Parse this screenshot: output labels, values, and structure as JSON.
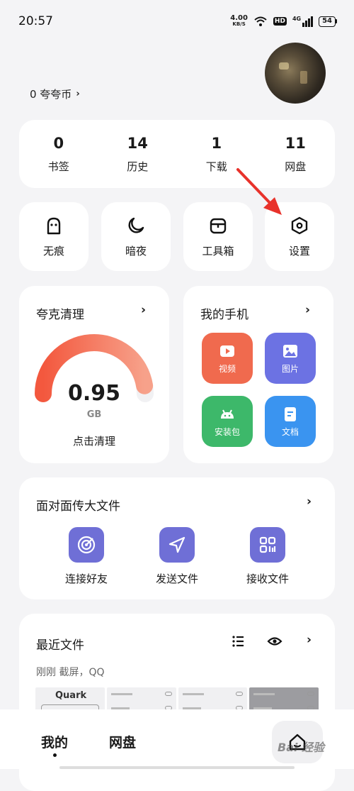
{
  "status_bar": {
    "time": "20:57",
    "net_speed_value": "4.00",
    "net_speed_unit": "KB/S",
    "hd_badge": "HD",
    "network_type": "4G",
    "battery": "54"
  },
  "profile": {
    "coins_label": "0 夸夸币",
    "coins_chevron": "›"
  },
  "stats": [
    {
      "value": "0",
      "label": "书签"
    },
    {
      "value": "14",
      "label": "历史"
    },
    {
      "value": "1",
      "label": "下载"
    },
    {
      "value": "11",
      "label": "网盘"
    }
  ],
  "quick_actions": [
    {
      "label": "无痕",
      "icon": "ghost-icon"
    },
    {
      "label": "暗夜",
      "icon": "moon-icon"
    },
    {
      "label": "工具箱",
      "icon": "toolbox-icon"
    },
    {
      "label": "设置",
      "icon": "settings-hexagon-icon"
    }
  ],
  "clean": {
    "title": "夸克清理",
    "chevron": "›",
    "value": "0.95",
    "unit": "GB",
    "action": "点击清理",
    "gauge_fraction": 0.95
  },
  "my_phone": {
    "title": "我的手机",
    "chevron": "›",
    "tiles": [
      {
        "label": "视频",
        "icon": "video-icon",
        "color": "#f06a4e"
      },
      {
        "label": "图片",
        "icon": "image-icon",
        "color": "#6c72e3"
      },
      {
        "label": "安装包",
        "icon": "android-icon",
        "color": "#3db86a"
      },
      {
        "label": "文档",
        "icon": "document-icon",
        "color": "#3a94f0"
      }
    ]
  },
  "transfer": {
    "title": "面对面传大文件",
    "chevron": "›",
    "items": [
      {
        "label": "连接好友",
        "icon": "radar-icon"
      },
      {
        "label": "发送文件",
        "icon": "send-icon"
      },
      {
        "label": "接收文件",
        "icon": "scan-grid-icon"
      }
    ]
  },
  "recent": {
    "title": "最近文件",
    "subtitle": "刚刚 截屏，QQ",
    "chevron": "›",
    "list_icon": "list-icon",
    "eye_icon": "eye-icon",
    "thumb_label": "Quark"
  },
  "bottom_nav": {
    "tab_mine": "我的",
    "tab_cloud": "网盘",
    "home_icon": "home-icon",
    "watermark": "Bai 经验"
  },
  "colors": {
    "accent_red": "#e8322b",
    "gauge_start": "#f06a4e",
    "gauge_end": "#f6a98f"
  }
}
